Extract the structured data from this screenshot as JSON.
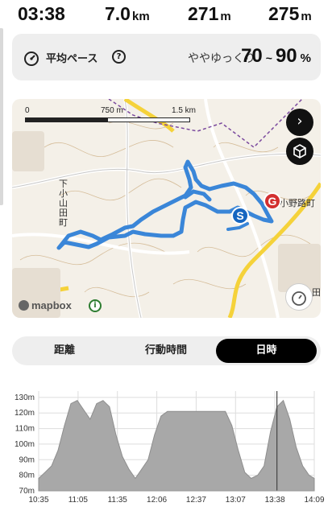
{
  "stats": {
    "time": "03:38",
    "distance": "7.0",
    "distance_unit": "km",
    "ascent": "271",
    "ascent_unit": "m",
    "descent": "275",
    "descent_unit": "m"
  },
  "pace": {
    "label": "平均ペース",
    "help": "?",
    "description": "ややゆっくり",
    "min": "70",
    "tilde": "~",
    "max": "90",
    "unit": "%"
  },
  "map": {
    "scale_zero": "0",
    "scale_mid": "750 m",
    "scale_end": "1.5 km",
    "place_left": "下小山田町",
    "place_right": "小野路町",
    "place_lower": "田",
    "start_marker": "S",
    "goal_marker": "G",
    "attribution": "mapbox",
    "info": "i",
    "nav_button": "›",
    "route_color": "#3a86d8"
  },
  "tabs": [
    {
      "label": "距離"
    },
    {
      "label": "行動時間"
    },
    {
      "label": "日時"
    }
  ],
  "chart_data": {
    "type": "area",
    "x_ticks": [
      "10:35",
      "11:05",
      "11:35",
      "12:06",
      "12:37",
      "13:07",
      "13:38",
      "14:09"
    ],
    "y_ticks": [
      "130m",
      "120m",
      "110m",
      "100m",
      "90m",
      "80m",
      "70m"
    ],
    "ylim": [
      70,
      132
    ],
    "xlabel": "",
    "ylabel": "",
    "grid": true,
    "fill_color": "#a8a8a8",
    "current_marker_time": "13:40",
    "x": [
      "10:35",
      "10:40",
      "10:45",
      "10:50",
      "10:55",
      "11:00",
      "11:05",
      "11:10",
      "11:15",
      "11:20",
      "11:25",
      "11:30",
      "11:35",
      "11:40",
      "11:45",
      "11:50",
      "11:55",
      "12:00",
      "12:05",
      "12:10",
      "12:15",
      "12:20",
      "12:25",
      "12:30",
      "12:35",
      "12:40",
      "12:45",
      "12:50",
      "12:55",
      "13:00",
      "13:05",
      "13:10",
      "13:15",
      "13:20",
      "13:25",
      "13:30",
      "13:35",
      "13:40",
      "13:45",
      "13:50",
      "13:55",
      "14:00",
      "14:05",
      "14:09"
    ],
    "y": [
      78,
      82,
      86,
      96,
      112,
      126,
      128,
      122,
      116,
      126,
      128,
      124,
      106,
      92,
      84,
      78,
      84,
      90,
      106,
      118,
      121,
      121,
      121,
      121,
      121,
      121,
      121,
      121,
      121,
      121,
      112,
      96,
      82,
      78,
      80,
      86,
      108,
      124,
      128,
      116,
      98,
      86,
      80,
      78
    ]
  }
}
